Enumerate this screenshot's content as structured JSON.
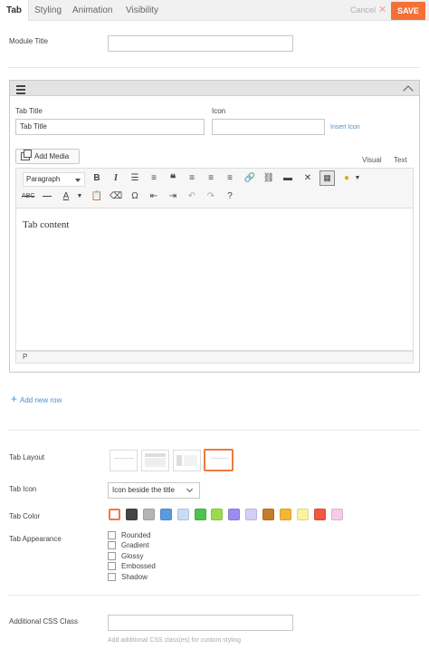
{
  "tabs": {
    "items": [
      {
        "label": "Tab",
        "active": true
      },
      {
        "label": "Styling"
      },
      {
        "label": "Animation"
      },
      {
        "label": "Visibility"
      }
    ]
  },
  "actions": {
    "cancel": "Cancel",
    "save": "SAVE"
  },
  "module_title": {
    "label": "Module Title",
    "value": ""
  },
  "row": {
    "tab_title_label": "Tab Title",
    "tab_title_value": "Tab Title",
    "icon_label": "Icon",
    "icon_value": "",
    "insert_icon": "Insert Icon",
    "add_media": "Add Media",
    "editor_tab_visual": "Visual",
    "editor_tab_text": "Text",
    "format_select": "Paragraph",
    "content": "Tab content",
    "path": "P"
  },
  "add_new_row": "Add new row",
  "tab_layout": {
    "label": "Tab Layout",
    "selected_index": 3
  },
  "tab_icon": {
    "label": "Tab Icon",
    "value": "Icon beside the title"
  },
  "tab_color": {
    "label": "Tab Color",
    "swatches": [
      "default",
      "#444444",
      "#b5b5b5",
      "#5a9be0",
      "#c8dcf7",
      "#4ec24e",
      "#9bdc4a",
      "#9a8cf0",
      "#d4d0f5",
      "#c77a2a",
      "#f5b731",
      "#fbf49e",
      "#f0583f",
      "#f7cbe5"
    ],
    "selected_index": 0
  },
  "tab_appearance": {
    "label": "Tab Appearance",
    "options": [
      "Rounded",
      "Gradient",
      "Glossy",
      "Embossed",
      "Shadow"
    ]
  },
  "css_class": {
    "label": "Additional CSS Class",
    "value": "",
    "help": "Add additional CSS class(es) for custom styling"
  }
}
